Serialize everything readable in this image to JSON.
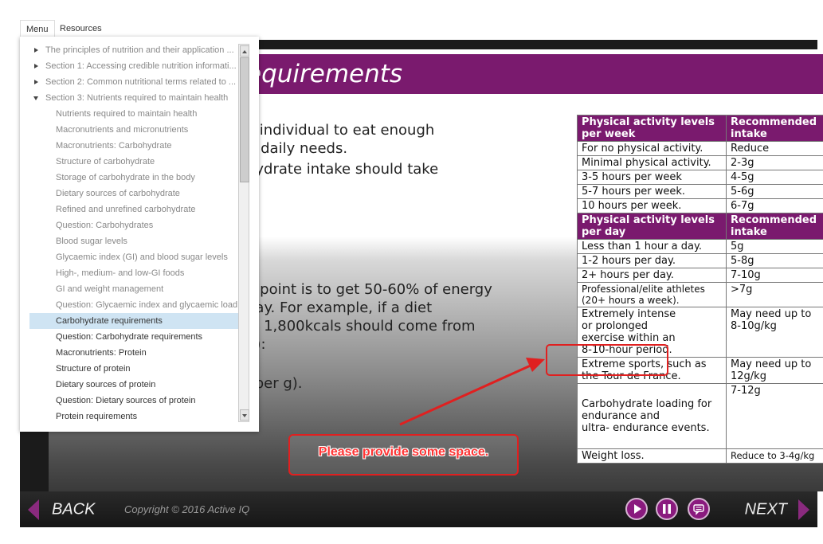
{
  "menu_tabs": {
    "menu": "Menu",
    "resources": "Resources"
  },
  "menu_items": {
    "s0": "The principles of nutrition and their application ...",
    "s1": "Section 1: Accessing credible nutrition informati...",
    "s2": "Section 2: Common nutritional terms related to ...",
    "s3": "Section 3: Nutrients required to maintain health",
    "i0": "Nutrients required to maintain health",
    "i1": "Macronutrients and micronutrients",
    "i2": "Macronutrients: Carbohydrate",
    "i3": "Structure of carbohydrate",
    "i4": "Storage of carbohydrate in the body",
    "i5": "Dietary sources of carbohydrate",
    "i6": "Refined and unrefined carbohydrate",
    "i7": "Question: Carbohydrates",
    "i8": "Blood sugar levels",
    "i9": "Glycaemic index (GI) and blood sugar levels",
    "i10": "High-, medium- and low-GI foods",
    "i11": "GI and weight management",
    "i12": "Question: Glycaemic index and glycaemic load",
    "i13": "Carbohydrate requirements",
    "i14": "Question: Carbohydrate requirements",
    "i15": "Macronutrients: Protein",
    "i16": "Structure of protein",
    "i17": "Dietary sources of protein",
    "i18": "Question: Dietary sources of protein",
    "i19": "Protein requirements"
  },
  "slide": {
    "title": "equirements",
    "para1": [
      "e individual to eat enough",
      "ir daily needs.",
      "hydrate intake should take"
    ],
    "para2": [
      "g point is to get 50-60% of energy",
      "day. For example, if a diet",
      "y, 1,800kcals should come from",
      "g):"
    ],
    "para3": "l per g)."
  },
  "table": {
    "h1a": "Physical activity levels\nper week",
    "h1b": "Recommended\nintake",
    "r1a": "For no physical activity.",
    "r1b": "Reduce",
    "r2a": "Minimal physical activity.",
    "r2b": "2-3g",
    "r3a": "3-5 hours per week",
    "r3b": "4-5g",
    "r4a": "5-7 hours per week.",
    "r4b": "5-6g",
    "r5a": "10 hours per week.",
    "r5b": "6-7g",
    "h2a": "Physical activity levels\nper day",
    "h2b": "Recommended\nintake",
    "d1a": "Less than 1 hour a day.",
    "d1b": "5g",
    "d2a": "1-2 hours per day.",
    "d2b": "5-8g",
    "d3a": "2+ hours per day.",
    "d3b": "7-10g",
    "d4a": "Professional/elite athletes\n(20+ hours a week).",
    "d4b": ">7g",
    "d5a": "Extremely intense\nor prolonged\nexercise within an\n8-10-hour period.",
    "d5b": "May need up to\n8-10g/kg",
    "d6a": "Extreme sports, such as\nthe Tour de France.",
    "d6b": "May need up to\n12g/kg",
    "d7a": "Carbohydrate loading for\nendurance and\nultra- endurance events.",
    "d7b": "7-12g",
    "d8a": "Weight loss.",
    "d8b": "Reduce to 3-4g/kg"
  },
  "bottom": {
    "back": "BACK",
    "copyright": "Copyright © 2016 Active IQ",
    "next": "NEXT"
  },
  "annotation": {
    "callout": "Please provide some space."
  },
  "colors": {
    "accent": "#7a1a6e",
    "annotation": "#e02020",
    "selected": "#cfe4f3"
  }
}
